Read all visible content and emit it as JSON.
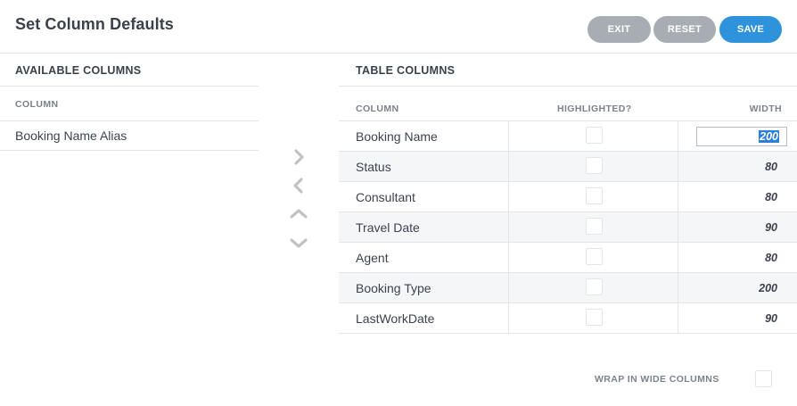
{
  "header": {
    "title": "Set Column Defaults",
    "exit_label": "EXIT",
    "reset_label": "RESET",
    "save_label": "SAVE"
  },
  "available": {
    "title": "AVAILABLE COLUMNS",
    "column_header": "COLUMN",
    "items": [
      {
        "label": "Booking Name Alias"
      }
    ]
  },
  "table": {
    "title": "TABLE COLUMNS",
    "headers": {
      "column": "COLUMN",
      "highlighted": "HIGHLIGHTED?",
      "width": "WIDTH"
    },
    "rows": [
      {
        "name": "Booking Name",
        "highlighted": false,
        "width": "200"
      },
      {
        "name": "Status",
        "highlighted": false,
        "width": "80"
      },
      {
        "name": "Consultant",
        "highlighted": false,
        "width": "80"
      },
      {
        "name": "Travel Date",
        "highlighted": false,
        "width": "90"
      },
      {
        "name": "Agent",
        "highlighted": false,
        "width": "80"
      },
      {
        "name": "Booking Type",
        "highlighted": false,
        "width": "200"
      },
      {
        "name": "LastWorkDate",
        "highlighted": false,
        "width": "90"
      }
    ]
  },
  "options": {
    "wrap_label": "WRAP IN WIDE COLUMNS",
    "wrap_checked": false
  },
  "colors": {
    "accent": "#2f93dc",
    "secondary_button": "#a8adb3",
    "alt_row": "#f5f6f7",
    "arrow": "#bfc3c8"
  },
  "icons": [
    "chevron-right-icon",
    "chevron-left-icon",
    "chevron-up-icon",
    "chevron-down-icon"
  ]
}
